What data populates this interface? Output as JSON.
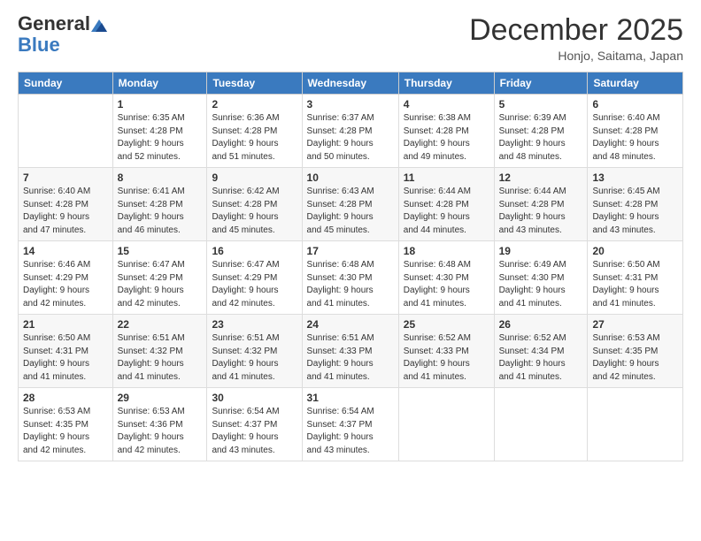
{
  "logo": {
    "general": "General",
    "blue": "Blue"
  },
  "header": {
    "month": "December 2025",
    "location": "Honjo, Saitama, Japan"
  },
  "days_of_week": [
    "Sunday",
    "Monday",
    "Tuesday",
    "Wednesday",
    "Thursday",
    "Friday",
    "Saturday"
  ],
  "weeks": [
    [
      {
        "day": "",
        "info": ""
      },
      {
        "day": "1",
        "info": "Sunrise: 6:35 AM\nSunset: 4:28 PM\nDaylight: 9 hours\nand 52 minutes."
      },
      {
        "day": "2",
        "info": "Sunrise: 6:36 AM\nSunset: 4:28 PM\nDaylight: 9 hours\nand 51 minutes."
      },
      {
        "day": "3",
        "info": "Sunrise: 6:37 AM\nSunset: 4:28 PM\nDaylight: 9 hours\nand 50 minutes."
      },
      {
        "day": "4",
        "info": "Sunrise: 6:38 AM\nSunset: 4:28 PM\nDaylight: 9 hours\nand 49 minutes."
      },
      {
        "day": "5",
        "info": "Sunrise: 6:39 AM\nSunset: 4:28 PM\nDaylight: 9 hours\nand 48 minutes."
      },
      {
        "day": "6",
        "info": "Sunrise: 6:40 AM\nSunset: 4:28 PM\nDaylight: 9 hours\nand 48 minutes."
      }
    ],
    [
      {
        "day": "7",
        "info": "Sunrise: 6:40 AM\nSunset: 4:28 PM\nDaylight: 9 hours\nand 47 minutes."
      },
      {
        "day": "8",
        "info": "Sunrise: 6:41 AM\nSunset: 4:28 PM\nDaylight: 9 hours\nand 46 minutes."
      },
      {
        "day": "9",
        "info": "Sunrise: 6:42 AM\nSunset: 4:28 PM\nDaylight: 9 hours\nand 45 minutes."
      },
      {
        "day": "10",
        "info": "Sunrise: 6:43 AM\nSunset: 4:28 PM\nDaylight: 9 hours\nand 45 minutes."
      },
      {
        "day": "11",
        "info": "Sunrise: 6:44 AM\nSunset: 4:28 PM\nDaylight: 9 hours\nand 44 minutes."
      },
      {
        "day": "12",
        "info": "Sunrise: 6:44 AM\nSunset: 4:28 PM\nDaylight: 9 hours\nand 43 minutes."
      },
      {
        "day": "13",
        "info": "Sunrise: 6:45 AM\nSunset: 4:28 PM\nDaylight: 9 hours\nand 43 minutes."
      }
    ],
    [
      {
        "day": "14",
        "info": "Sunrise: 6:46 AM\nSunset: 4:29 PM\nDaylight: 9 hours\nand 42 minutes."
      },
      {
        "day": "15",
        "info": "Sunrise: 6:47 AM\nSunset: 4:29 PM\nDaylight: 9 hours\nand 42 minutes."
      },
      {
        "day": "16",
        "info": "Sunrise: 6:47 AM\nSunset: 4:29 PM\nDaylight: 9 hours\nand 42 minutes."
      },
      {
        "day": "17",
        "info": "Sunrise: 6:48 AM\nSunset: 4:30 PM\nDaylight: 9 hours\nand 41 minutes."
      },
      {
        "day": "18",
        "info": "Sunrise: 6:48 AM\nSunset: 4:30 PM\nDaylight: 9 hours\nand 41 minutes."
      },
      {
        "day": "19",
        "info": "Sunrise: 6:49 AM\nSunset: 4:30 PM\nDaylight: 9 hours\nand 41 minutes."
      },
      {
        "day": "20",
        "info": "Sunrise: 6:50 AM\nSunset: 4:31 PM\nDaylight: 9 hours\nand 41 minutes."
      }
    ],
    [
      {
        "day": "21",
        "info": "Sunrise: 6:50 AM\nSunset: 4:31 PM\nDaylight: 9 hours\nand 41 minutes."
      },
      {
        "day": "22",
        "info": "Sunrise: 6:51 AM\nSunset: 4:32 PM\nDaylight: 9 hours\nand 41 minutes."
      },
      {
        "day": "23",
        "info": "Sunrise: 6:51 AM\nSunset: 4:32 PM\nDaylight: 9 hours\nand 41 minutes."
      },
      {
        "day": "24",
        "info": "Sunrise: 6:51 AM\nSunset: 4:33 PM\nDaylight: 9 hours\nand 41 minutes."
      },
      {
        "day": "25",
        "info": "Sunrise: 6:52 AM\nSunset: 4:33 PM\nDaylight: 9 hours\nand 41 minutes."
      },
      {
        "day": "26",
        "info": "Sunrise: 6:52 AM\nSunset: 4:34 PM\nDaylight: 9 hours\nand 41 minutes."
      },
      {
        "day": "27",
        "info": "Sunrise: 6:53 AM\nSunset: 4:35 PM\nDaylight: 9 hours\nand 42 minutes."
      }
    ],
    [
      {
        "day": "28",
        "info": "Sunrise: 6:53 AM\nSunset: 4:35 PM\nDaylight: 9 hours\nand 42 minutes."
      },
      {
        "day": "29",
        "info": "Sunrise: 6:53 AM\nSunset: 4:36 PM\nDaylight: 9 hours\nand 42 minutes."
      },
      {
        "day": "30",
        "info": "Sunrise: 6:54 AM\nSunset: 4:37 PM\nDaylight: 9 hours\nand 43 minutes."
      },
      {
        "day": "31",
        "info": "Sunrise: 6:54 AM\nSunset: 4:37 PM\nDaylight: 9 hours\nand 43 minutes."
      },
      {
        "day": "",
        "info": ""
      },
      {
        "day": "",
        "info": ""
      },
      {
        "day": "",
        "info": ""
      }
    ]
  ]
}
